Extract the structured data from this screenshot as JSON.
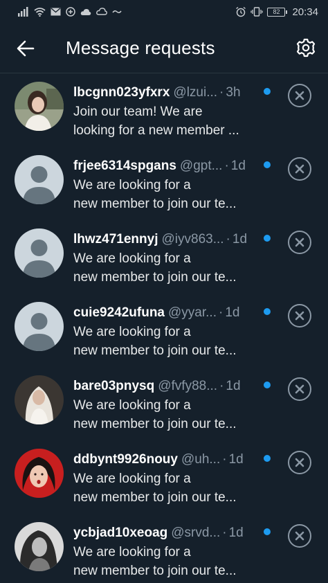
{
  "status_bar": {
    "battery_level": "82",
    "time": "20:34"
  },
  "header": {
    "title": "Message requests"
  },
  "requests": [
    {
      "name": "lbcgnn023yfxrx",
      "handle": "@lzui...",
      "time": "3h",
      "line1": "Join our team! We are",
      "line2": "looking for a new member ...",
      "avatar": "photo-woman-outdoor"
    },
    {
      "name": "frjee6314spgans",
      "handle": "@gpt...",
      "time": "1d",
      "line1": "We are looking for a",
      "line2": "new member to join our te...",
      "avatar": "default-avatar"
    },
    {
      "name": "lhwz471ennyj",
      "handle": "@iyv863...",
      "time": "1d",
      "line1": "We are looking for a",
      "line2": "new member to join our te...",
      "avatar": "default-avatar"
    },
    {
      "name": "cuie9242ufuna",
      "handle": "@yyar...",
      "time": "1d",
      "line1": "We are looking for a",
      "line2": "new member to join our te...",
      "avatar": "default-avatar"
    },
    {
      "name": "bare03pnysq",
      "handle": "@fvfy88...",
      "time": "1d",
      "line1": "We are looking for a",
      "line2": "new member to join our te...",
      "avatar": "photo-veil"
    },
    {
      "name": "ddbynt9926nouy",
      "handle": "@uh...",
      "time": "1d",
      "line1": "We are looking for a",
      "line2": "new member to join our te...",
      "avatar": "photo-red-background"
    },
    {
      "name": "ycbjad10xeoag",
      "handle": "@srvd...",
      "time": "1d",
      "line1": "We are looking for a",
      "line2": "new member to join our te...",
      "avatar": "photo-monochrome"
    }
  ],
  "colors": {
    "background": "#15202b",
    "accent": "#1d9bf0",
    "muted": "#8b98a5"
  }
}
